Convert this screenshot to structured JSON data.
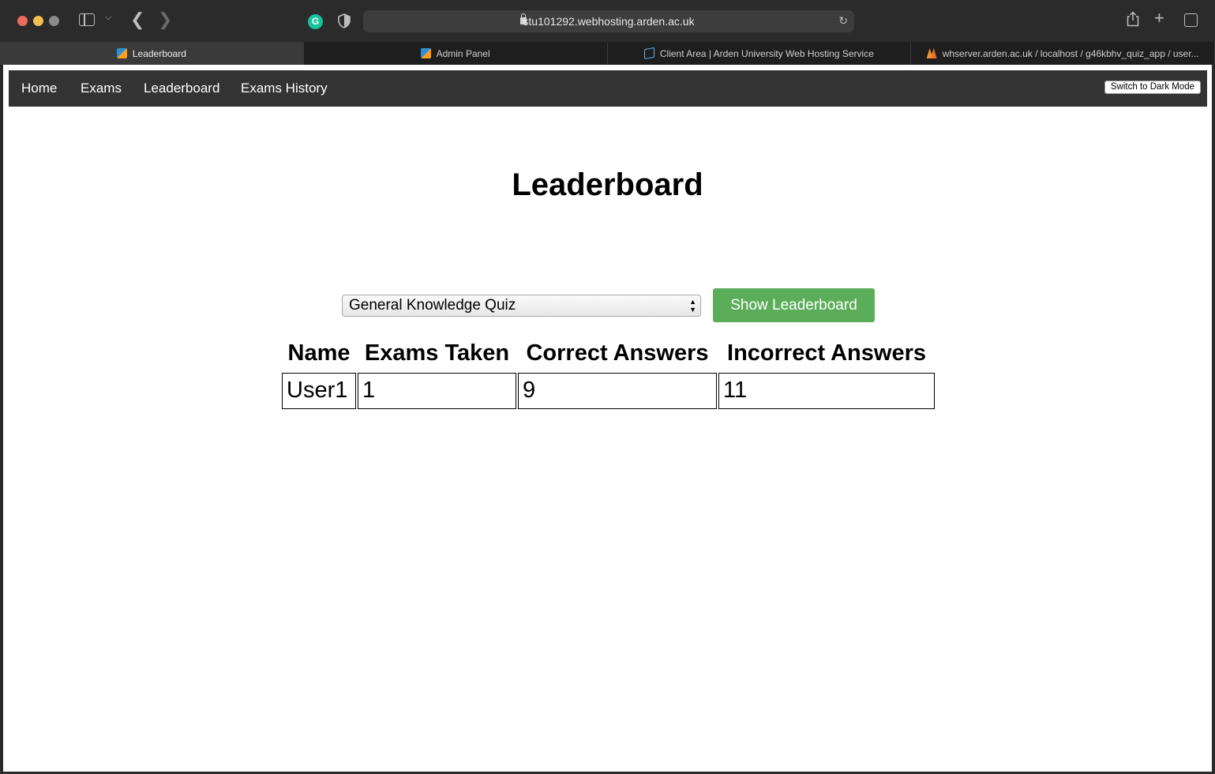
{
  "browser": {
    "url": "stu101292.webhosting.arden.ac.uk",
    "tabs": [
      {
        "label": "Leaderboard",
        "active": true,
        "icon": "leaderboard-favicon"
      },
      {
        "label": "Admin Panel",
        "active": false,
        "icon": "leaderboard-favicon"
      },
      {
        "label": "Client Area | Arden University Web Hosting Service",
        "active": false,
        "icon": "cube-favicon"
      },
      {
        "label": "whserver.arden.ac.uk / localhost / g46kbhv_quiz_app / user...",
        "active": false,
        "icon": "phpmyadmin-favicon"
      }
    ],
    "grammarly_glyph": "G"
  },
  "nav": {
    "home": "Home",
    "exams": "Exams",
    "leaderboard": "Leaderboard",
    "history": "Exams History",
    "dark_mode": "Switch to Dark Mode"
  },
  "page": {
    "title": "Leaderboard",
    "quiz_select": {
      "selected": "General Knowledge Quiz"
    },
    "show_button": "Show Leaderboard"
  },
  "table": {
    "headers": [
      "Name",
      "Exams Taken",
      "Correct Answers",
      "Incorrect Answers"
    ],
    "rows": [
      [
        "User1",
        "1",
        "9",
        "11"
      ]
    ]
  },
  "colors": {
    "navbar": "#333333",
    "button_green": "#5cad5a"
  }
}
